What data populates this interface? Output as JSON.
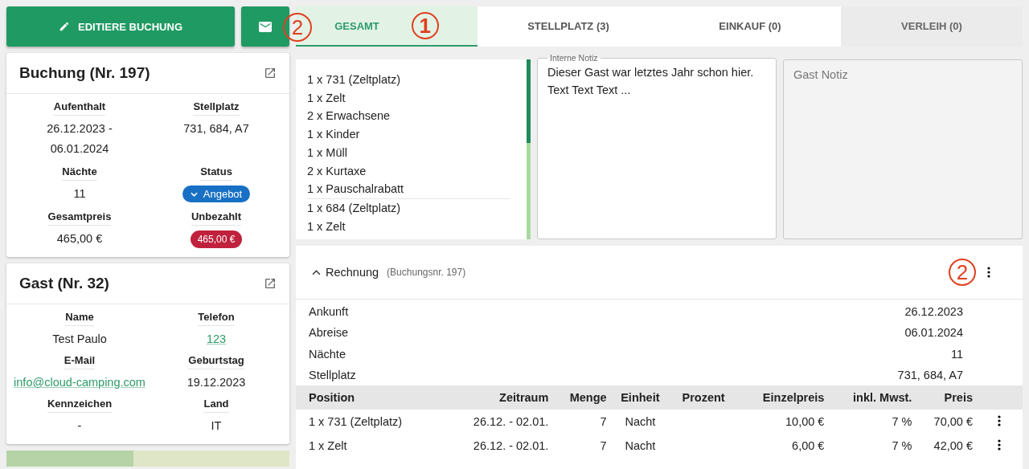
{
  "actions": {
    "edit_button": "EDITIERE BUCHUNG",
    "mail_marker": "2"
  },
  "booking": {
    "title": "Buchung (Nr. 197)",
    "fields": [
      {
        "label": "Aufenthalt",
        "value": "26.12.2023 -\n06.01.2024",
        "kind": "text"
      },
      {
        "label": "Stellplatz",
        "value": "731, 684, A7",
        "kind": "text"
      },
      {
        "label": "Nächte",
        "value": "11",
        "kind": "text"
      },
      {
        "label": "Status",
        "value": "Angebot",
        "kind": "status"
      },
      {
        "label": "Gesamtpreis",
        "value": "465,00 €",
        "kind": "text"
      },
      {
        "label": "Unbezahlt",
        "value": "465,00 €",
        "kind": "unpaid"
      }
    ]
  },
  "guest": {
    "title": "Gast (Nr. 32)",
    "fields": [
      {
        "label": "Name",
        "value": "Test Paulo",
        "kind": "text"
      },
      {
        "label": "Telefon",
        "value": "123",
        "kind": "link"
      },
      {
        "label": "E-Mail",
        "value": "info@cloud-camping.com",
        "kind": "link"
      },
      {
        "label": "Geburtstag",
        "value": "19.12.2023",
        "kind": "text"
      },
      {
        "label": "Kennzeichen",
        "value": "-",
        "kind": "text"
      },
      {
        "label": "Land",
        "value": "IT",
        "kind": "text"
      }
    ]
  },
  "tabs": [
    {
      "label": "GESAMT",
      "selected": true,
      "disabled": false,
      "marker": "1"
    },
    {
      "label": "STELLPLATZ (3)",
      "selected": false,
      "disabled": false
    },
    {
      "label": "EINKAUF (0)",
      "selected": false,
      "disabled": false
    },
    {
      "label": "VERLEIH (0)",
      "selected": false,
      "disabled": true
    }
  ],
  "positions": [
    [
      "1 x 731 (Zeltplatz)",
      "1 x Zelt",
      "2 x Erwachsene",
      "1 x Kinder",
      "1 x Müll",
      "2 x Kurtaxe",
      "1 x Pauschalrabatt"
    ],
    [
      "1 x 684 (Zeltplatz)",
      "1 x Zelt"
    ]
  ],
  "internal_note": {
    "label": "Interne Notiz",
    "value": "Dieser Gast war letztes Jahr schon hier.\nText Text Text ..."
  },
  "guest_note": {
    "placeholder": "Gast Notiz",
    "disabled": true
  },
  "invoice": {
    "title": "Rechnung",
    "subtitle": "(Buchungsnr. 197)",
    "expanded": true,
    "marker": "2",
    "info": [
      {
        "label": "Ankunft",
        "value": "26.12.2023"
      },
      {
        "label": "Abreise",
        "value": "06.01.2024"
      },
      {
        "label": "Nächte",
        "value": "11"
      },
      {
        "label": "Stellplatz",
        "value": "731, 684, A7"
      }
    ],
    "columns": [
      "Position",
      "Zeitraum",
      "Menge",
      "Einheit",
      "Prozent",
      "Einzelpreis",
      "inkl. Mwst.",
      "Preis"
    ],
    "rows": [
      [
        "1 x 731 (Zeltplatz)",
        "26.12. - 02.01.",
        "7",
        "Nacht",
        "",
        "10,00 €",
        "7 %",
        "70,00 €"
      ],
      [
        "1 x Zelt",
        "26.12. - 02.01.",
        "7",
        "Nacht",
        "",
        "6,00 €",
        "7 %",
        "42,00 €"
      ]
    ]
  }
}
